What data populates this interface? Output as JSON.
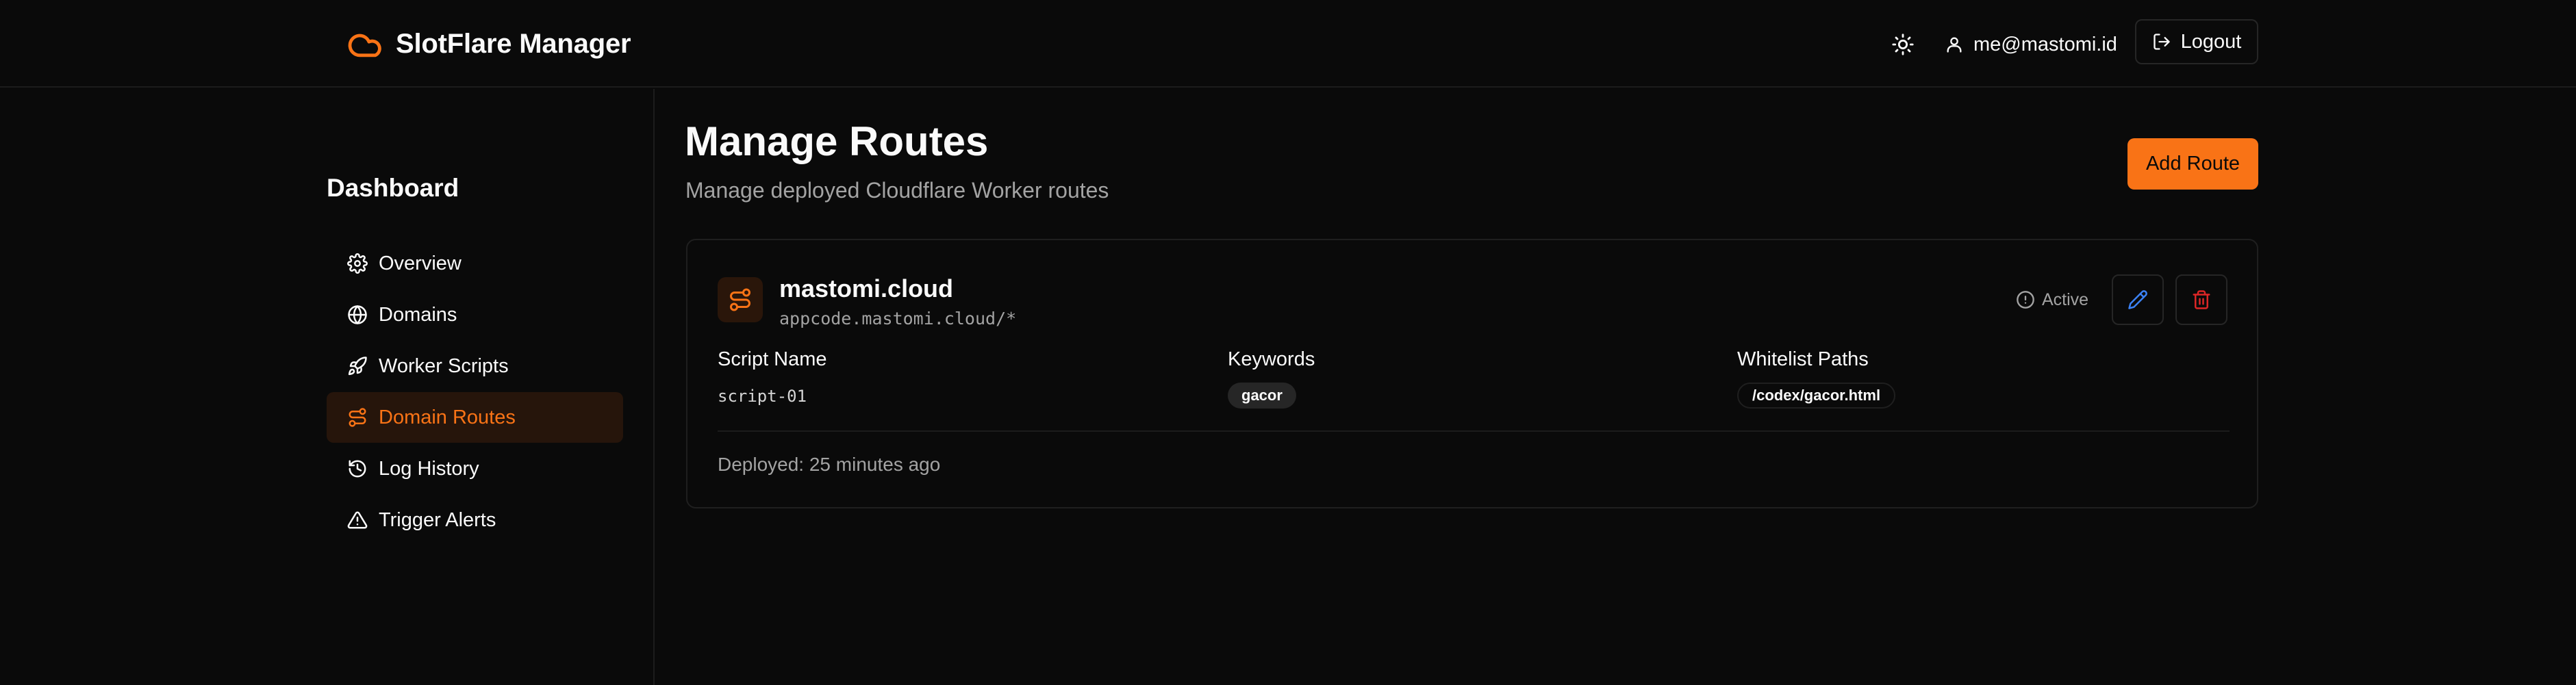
{
  "header": {
    "app_title": "SlotFlare Manager",
    "brand_icon": "cloud-icon",
    "theme_icon": "sun-icon",
    "user_icon": "user-icon",
    "user_email": "me@mastomi.id",
    "logout_label": "Logout",
    "logout_icon": "log-out-icon"
  },
  "sidebar": {
    "title": "Dashboard",
    "items": [
      {
        "label": "Overview",
        "icon": "gear-icon",
        "active": false
      },
      {
        "label": "Domains",
        "icon": "globe-icon",
        "active": false
      },
      {
        "label": "Worker Scripts",
        "icon": "rocket-icon",
        "active": false
      },
      {
        "label": "Domain Routes",
        "icon": "route-icon",
        "active": true
      },
      {
        "label": "Log History",
        "icon": "history-icon",
        "active": false
      },
      {
        "label": "Trigger Alerts",
        "icon": "alert-triangle-icon",
        "active": false
      }
    ]
  },
  "main": {
    "title": "Manage Routes",
    "subtitle": "Manage deployed Cloudflare Worker routes",
    "add_route_label": "Add Route",
    "routes": [
      {
        "domain": "mastomi.cloud",
        "pattern": "appcode.mastomi.cloud/*",
        "status": "Active",
        "script_name_label": "Script Name",
        "script_name": "script-01",
        "keywords_label": "Keywords",
        "keywords": [
          "gacor"
        ],
        "whitelist_label": "Whitelist Paths",
        "whitelist_paths": [
          "/codex/gacor.html"
        ],
        "deployed": "Deployed: 25 minutes ago"
      }
    ]
  },
  "colors": {
    "background": "#0a0a0a",
    "accent": "#f97316",
    "active_nav_bg": "#26150b",
    "muted_text": "#a3a3a3",
    "border": "#262626",
    "edit_icon": "#3b82f6",
    "delete_icon": "#dc2626"
  }
}
